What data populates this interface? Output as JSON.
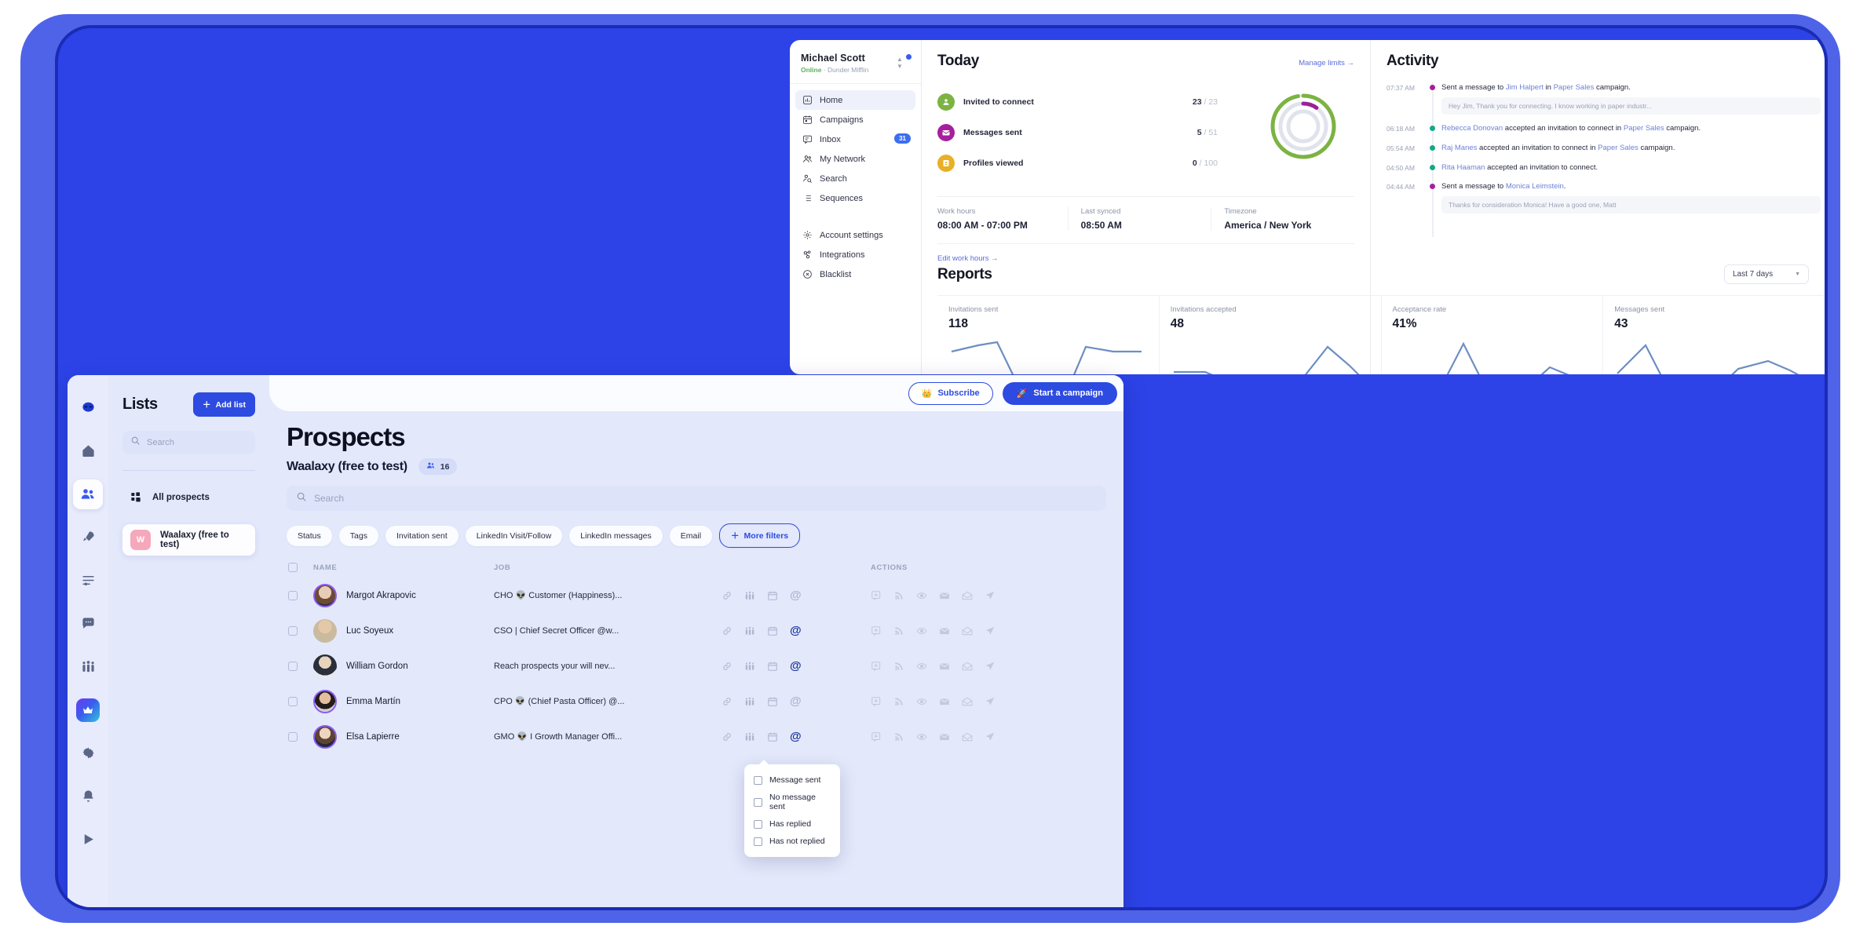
{
  "dashboard": {
    "user": {
      "name": "Michael Scott",
      "status": "Online",
      "company": "Dunder Mifflin",
      "separator": "·"
    },
    "nav": [
      {
        "label": "Home",
        "icon": "chart-bars-icon",
        "active": true,
        "badge": ""
      },
      {
        "label": "Campaigns",
        "icon": "calendar-icon",
        "active": false,
        "badge": ""
      },
      {
        "label": "Inbox",
        "icon": "message-square-icon",
        "active": false,
        "badge": "31"
      },
      {
        "label": "My Network",
        "icon": "users-icon",
        "active": false,
        "badge": ""
      },
      {
        "label": "Search",
        "icon": "person-search-icon",
        "active": false,
        "badge": ""
      },
      {
        "label": "Sequences",
        "icon": "list-icon",
        "active": false,
        "badge": ""
      }
    ],
    "nav_secondary": [
      {
        "label": "Account settings",
        "icon": "gear-icon"
      },
      {
        "label": "Integrations",
        "icon": "integrations-icon"
      },
      {
        "label": "Blacklist",
        "icon": "circle-x-icon"
      }
    ],
    "today": {
      "title": "Today",
      "manage_link": "Manage limits",
      "stats": [
        {
          "label": "Invited to connect",
          "value": "23",
          "limit": "23",
          "color": "#7cb342",
          "icon": "user-plus-icon"
        },
        {
          "label": "Messages sent",
          "value": "5",
          "limit": "51",
          "color": "#a5209c",
          "icon": "envelope-icon"
        },
        {
          "label": "Profiles viewed",
          "value": "0",
          "limit": "100",
          "color": "#e8b024",
          "icon": "id-card-icon"
        }
      ],
      "meta": [
        {
          "key": "Work hours",
          "value": "08:00 AM - 07:00 PM"
        },
        {
          "key": "Last synced",
          "value": "08:50 AM"
        },
        {
          "key": "Timezone",
          "value": "America / New York"
        }
      ],
      "edit_link": "Edit work hours"
    },
    "reports": {
      "title": "Reports",
      "range": "Last 7 days",
      "cards": [
        {
          "label": "Invitations sent",
          "value": "118"
        },
        {
          "label": "Invitations accepted",
          "value": "48"
        },
        {
          "label": "Acceptance rate",
          "value": "41%"
        },
        {
          "label": "Messages sent",
          "value": "43"
        }
      ]
    },
    "activity": {
      "title": "Activity",
      "items": [
        {
          "time": "07:37 AM",
          "dot": "#a5209c",
          "parts": [
            {
              "t": "Sent a message to ",
              "link": false
            },
            {
              "t": "Jim Halpert",
              "link": true
            },
            {
              "t": " in ",
              "link": false
            },
            {
              "t": "Paper Sales",
              "link": true
            },
            {
              "t": " campaign.",
              "link": false
            }
          ],
          "quote": "Hey Jim, Thank you for connecting. I know working in paper industr..."
        },
        {
          "time": "06:18 AM",
          "dot": "#13a88a",
          "parts": [
            {
              "t": "Rebecca Donovan",
              "link": true
            },
            {
              "t": " accepted an invitation to connect in ",
              "link": false
            },
            {
              "t": "Paper Sales",
              "link": true
            },
            {
              "t": " campaign.",
              "link": false
            }
          ],
          "quote": ""
        },
        {
          "time": "05:54 AM",
          "dot": "#13a88a",
          "parts": [
            {
              "t": "Raj Manes",
              "link": true
            },
            {
              "t": " accepted an invitation to connect in ",
              "link": false
            },
            {
              "t": "Paper Sales",
              "link": true
            },
            {
              "t": " campaign.",
              "link": false
            }
          ],
          "quote": ""
        },
        {
          "time": "04:50 AM",
          "dot": "#13a88a",
          "parts": [
            {
              "t": "Rita Haaman",
              "link": true
            },
            {
              "t": " accepted an invitation to connect.",
              "link": false
            }
          ],
          "quote": ""
        },
        {
          "time": "04:44 AM",
          "dot": "#a5209c",
          "parts": [
            {
              "t": "Sent a message to ",
              "link": false
            },
            {
              "t": "Monica Leimstein",
              "link": true
            },
            {
              "t": ".",
              "link": false
            }
          ],
          "quote": "Thanks for consideration Monica! Have a good one, Matt"
        }
      ]
    }
  },
  "prospects": {
    "rail": [
      {
        "icon": "alien-logo-icon",
        "state": "logo"
      },
      {
        "icon": "home-icon",
        "state": "normal"
      },
      {
        "icon": "prospects-icon",
        "state": "selected"
      },
      {
        "icon": "rocket-icon",
        "state": "normal"
      },
      {
        "icon": "sequence-icon",
        "state": "normal"
      },
      {
        "icon": "chat-icon",
        "state": "normal"
      },
      {
        "icon": "team-icon",
        "state": "normal"
      },
      {
        "icon": "crown-icon",
        "state": "gradient"
      },
      {
        "icon": "gear-icon",
        "state": "normal"
      },
      {
        "icon": "bell-icon",
        "state": "normal"
      },
      {
        "icon": "play-icon",
        "state": "normal"
      }
    ],
    "lists": {
      "title": "Lists",
      "add_button": "Add list",
      "search_placeholder": "Search",
      "items": [
        {
          "label": "All prospects",
          "kind": "grid",
          "current": false
        },
        {
          "label": "Waalaxy (free to test)",
          "kind": "avatar",
          "initial": "W",
          "current": true
        }
      ]
    },
    "topbar": {
      "subscribe": "Subscribe",
      "start_campaign": "Start a campaign"
    },
    "header": {
      "title": "Prospects",
      "list_name": "Waalaxy (free to test)",
      "count": "16",
      "search_placeholder": "Search"
    },
    "filters": [
      {
        "label": "Status",
        "open": false
      },
      {
        "label": "Tags",
        "open": false
      },
      {
        "label": "Invitation sent",
        "open": false
      },
      {
        "label": "LinkedIn Visit/Follow",
        "open": false
      },
      {
        "label": "LinkedIn messages",
        "open": true
      },
      {
        "label": "Email",
        "open": false
      }
    ],
    "more_filters": "More filters",
    "dropdown": {
      "options": [
        {
          "label": "Message sent",
          "checked": false
        },
        {
          "label": "No message sent",
          "checked": false
        },
        {
          "label": "Has replied",
          "checked": false
        },
        {
          "label": "Has not replied",
          "checked": false
        }
      ]
    },
    "table": {
      "columns": {
        "name": "NAME",
        "job": "JOB",
        "actions": "ACTIONS"
      },
      "rows": [
        {
          "name": "Margot Akrapovic",
          "job": "CHO 👽 Customer (Happiness)...",
          "avatar": "#c9b9a4",
          "ring": true,
          "email_active": false
        },
        {
          "name": "Luc Soyeux",
          "job": "CSO | Chief Secret Officer @w...",
          "avatar": "#d9cbb6",
          "ring": false,
          "email_active": false
        },
        {
          "name": "William Gordon",
          "job": "Reach prospects your will nev...",
          "avatar": "#e4e4e8",
          "ring": false,
          "email_active": true
        },
        {
          "name": "Emma Martín",
          "job": "CPO 👽 (Chief Pasta Officer) @...",
          "avatar": "#b9a08c",
          "ring": true,
          "email_active": false
        },
        {
          "name": "Elsa Lapierre",
          "job": "GMO 👽 I Growth Manager Offi...",
          "avatar": "#cbbdb0",
          "ring": true,
          "email_active": true
        }
      ],
      "row_icons": [
        "link-icon",
        "team-icon",
        "calendar-icon",
        "at-icon"
      ],
      "action_icons": [
        "note-icon",
        "rss-follow-icon",
        "eye-visit-icon",
        "envelope-message-icon",
        "envelope-open-icon",
        "send-invite-icon"
      ]
    }
  },
  "colors": {
    "brand_blue": "#2d4be0",
    "shell_blue": "#4f63e8",
    "panel_bg": "#e3e8fb",
    "chart_line": "#6d8ec4",
    "green": "#7cb342",
    "purple": "#a5209c",
    "yellow": "#e8b024",
    "teal": "#13a88a"
  },
  "chart_data": [
    {
      "type": "line",
      "title": "Invitations sent",
      "value": 118,
      "x": [
        0,
        1,
        2,
        3,
        4,
        5,
        6,
        7
      ],
      "values": [
        62,
        72,
        76,
        0,
        0,
        70,
        64,
        62
      ],
      "ylim": [
        0,
        80
      ],
      "xlabel": "",
      "ylabel": "",
      "grid": false,
      "legend": "none"
    },
    {
      "type": "line",
      "title": "Invitations accepted",
      "value": 48,
      "x": [
        0,
        1,
        2,
        3,
        4,
        5,
        6,
        7
      ],
      "values": [
        26,
        26,
        18,
        8,
        2,
        12,
        56,
        36
      ],
      "ylim": [
        0,
        60
      ],
      "xlabel": "",
      "ylabel": "",
      "grid": false,
      "legend": "none"
    },
    {
      "type": "line",
      "title": "Acceptance rate",
      "value": "41%",
      "x": [
        0,
        1,
        2,
        3,
        4,
        5,
        6,
        7
      ],
      "values": [
        10,
        6,
        8,
        66,
        2,
        6,
        30,
        18
      ],
      "ylim": [
        0,
        70
      ],
      "xlabel": "",
      "ylabel": "",
      "grid": false,
      "legend": "none"
    },
    {
      "type": "line",
      "title": "Messages sent",
      "value": 43,
      "x": [
        0,
        1,
        2,
        3,
        4,
        5,
        6,
        7
      ],
      "values": [
        36,
        66,
        0,
        0,
        28,
        42,
        40,
        22
      ],
      "ylim": [
        0,
        70
      ],
      "xlabel": "",
      "ylabel": "",
      "grid": false,
      "legend": "none"
    },
    {
      "type": "pie",
      "title": "Today limits donut",
      "rings": [
        {
          "name": "Invited to connect",
          "value": 23,
          "max": 23,
          "color": "#7cb342"
        },
        {
          "name": "Messages sent",
          "value": 5,
          "max": 51,
          "color": "#a5209c"
        },
        {
          "name": "Profiles viewed",
          "value": 0,
          "max": 100,
          "color": "#d9dde8"
        }
      ]
    }
  ]
}
